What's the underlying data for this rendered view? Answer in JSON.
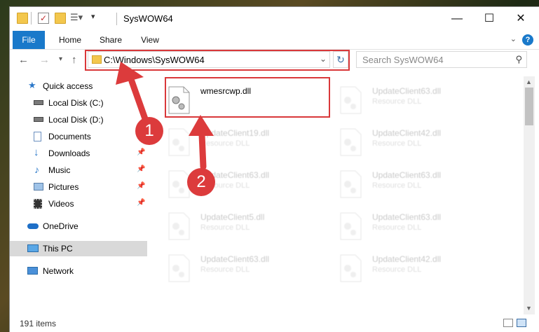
{
  "window": {
    "title": "SysWOW64"
  },
  "ribbon": {
    "tabs": [
      "File",
      "Home",
      "Share",
      "View"
    ],
    "help": "?"
  },
  "address": {
    "path": "C:\\Windows\\SysWOW64"
  },
  "search": {
    "placeholder": "Search SysWOW64"
  },
  "sidebar": {
    "items": [
      {
        "label": "Quick access",
        "icon": "star-icon"
      },
      {
        "label": "Local Disk (C:)",
        "icon": "drive-icon"
      },
      {
        "label": "Local Disk (D:)",
        "icon": "drive-icon"
      },
      {
        "label": "Documents",
        "icon": "documents-icon"
      },
      {
        "label": "Downloads",
        "icon": "download-icon"
      },
      {
        "label": "Music",
        "icon": "music-icon"
      },
      {
        "label": "Pictures",
        "icon": "pictures-icon"
      },
      {
        "label": "Videos",
        "icon": "videos-icon"
      },
      {
        "label": "OneDrive",
        "icon": "cloud-icon"
      },
      {
        "label": "This PC",
        "icon": "computer-icon"
      },
      {
        "label": "Network",
        "icon": "network-icon"
      }
    ]
  },
  "files": [
    {
      "name": "wmesrcwp.dll",
      "type": ""
    },
    {
      "name": "UpdateClient63.dll",
      "type": "Resource DLL"
    },
    {
      "name": "UpdateClient19.dll",
      "type": "Resource DLL"
    },
    {
      "name": "UpdateClient42.dll",
      "type": "Resource DLL"
    },
    {
      "name": "UpdateClient63.dll",
      "type": "Resource DLL"
    },
    {
      "name": "UpdateClient63.dll",
      "type": "Resource DLL"
    },
    {
      "name": "UpdateClient5.dll",
      "type": "Resource DLL"
    },
    {
      "name": "UpdateClient63.dll",
      "type": "Resource DLL"
    },
    {
      "name": "UpdateClient63.dll",
      "type": "Resource DLL"
    },
    {
      "name": "UpdateClient42.dll",
      "type": "Resource DLL"
    }
  ],
  "status": {
    "item_count": "191 items"
  },
  "annotations": {
    "badge1": "1",
    "badge2": "2"
  },
  "colors": {
    "accent": "#1979ca",
    "highlight": "#d9383a",
    "selection": "#d9d9d9"
  }
}
